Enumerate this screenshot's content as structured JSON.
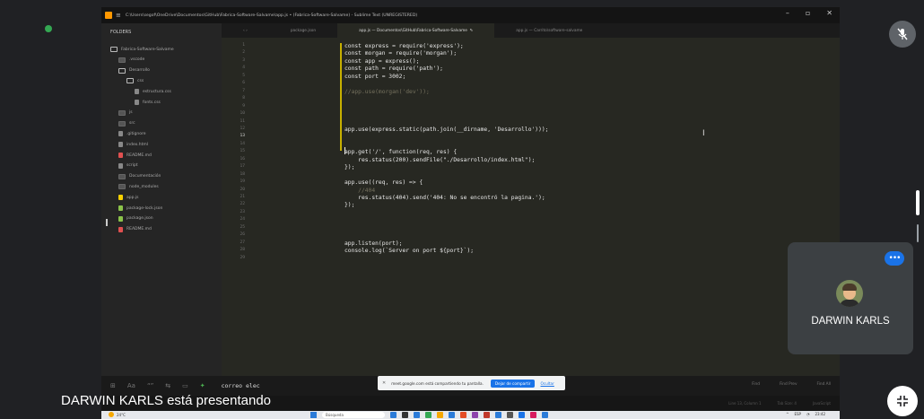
{
  "presenter_banner": "DARWIN KARLS está presentando",
  "participant": {
    "name": "DARWIN KARLS"
  },
  "window": {
    "title": "C:\\Users\\segof\\OneDrive\\Documentos\\GitHub\\Fabrica-Software-Salvame\\app.js • (Fabrica-Software-Salvame) - Sublime Text (UNREGISTERED)"
  },
  "sidebar": {
    "header": "FOLDERS",
    "items": [
      {
        "label": "Fabrica-Software-Salvame",
        "kind": "folder-open",
        "depth": 0
      },
      {
        "label": ".vscode",
        "kind": "folder",
        "depth": 1
      },
      {
        "label": "Desarrollo",
        "kind": "folder-open",
        "depth": 1
      },
      {
        "label": "css",
        "kind": "folder-open",
        "depth": 2
      },
      {
        "label": "estructura.css",
        "kind": "file",
        "depth": 3
      },
      {
        "label": "fonts.css",
        "kind": "file",
        "depth": 3
      },
      {
        "label": "js",
        "kind": "folder",
        "depth": 1
      },
      {
        "label": "src",
        "kind": "folder",
        "depth": 1
      },
      {
        "label": ".gitignore",
        "kind": "file",
        "depth": 1
      },
      {
        "label": "index.html",
        "kind": "file",
        "depth": 1
      },
      {
        "label": "README.md",
        "kind": "file",
        "depth": 1
      },
      {
        "label": "script",
        "kind": "file",
        "depth": 1
      },
      {
        "label": "Documentación",
        "kind": "folder",
        "depth": 1
      },
      {
        "label": "node_modules",
        "kind": "folder",
        "depth": 1
      },
      {
        "label": "app.js",
        "kind": "file",
        "depth": 1
      },
      {
        "label": "package-lock.json",
        "kind": "file",
        "depth": 1
      },
      {
        "label": "package.json",
        "kind": "file",
        "depth": 1
      },
      {
        "label": "README.md",
        "kind": "file",
        "depth": 1
      }
    ]
  },
  "tabs": [
    {
      "label": "package.json"
    },
    {
      "label": "app.js — Documentos\\GitHub\\Fabrica-Software-Salvame"
    },
    {
      "label": "app.js — Carrito\\software-salvame"
    }
  ],
  "code": {
    "current_line": "13",
    "lines": [
      {
        "n": "1",
        "text": "const express = require('express');",
        "comment": false
      },
      {
        "n": "2",
        "text": "const morgan = require('morgan');",
        "comment": false
      },
      {
        "n": "3",
        "text": "const app = express();",
        "comment": false
      },
      {
        "n": "4",
        "text": "const path = require('path');",
        "comment": false
      },
      {
        "n": "5",
        "text": "const port = 3002;",
        "comment": false
      },
      {
        "n": "6",
        "text": "",
        "comment": false
      },
      {
        "n": "7",
        "text": "//app.use(morgan('dev'));",
        "comment": true
      },
      {
        "n": "8",
        "text": "",
        "comment": false
      },
      {
        "n": "9",
        "text": "",
        "comment": false
      },
      {
        "n": "10",
        "text": "",
        "comment": false
      },
      {
        "n": "11",
        "text": "",
        "comment": false
      },
      {
        "n": "12",
        "text": "app.use(express.static(path.join(__dirname, 'Desarrollo')));",
        "comment": false
      },
      {
        "n": "13",
        "text": "",
        "comment": false
      },
      {
        "n": "14",
        "text": "",
        "comment": false
      },
      {
        "n": "15",
        "text": "app.get('/', function(req, res) {",
        "comment": false
      },
      {
        "n": "16",
        "text": "    res.status(200).sendFile(\"./Desarrollo/index.html\");",
        "comment": false
      },
      {
        "n": "17",
        "text": "});",
        "comment": false
      },
      {
        "n": "18",
        "text": "",
        "comment": false
      },
      {
        "n": "19",
        "text": "app.use((req, res) => {",
        "comment": false
      },
      {
        "n": "20",
        "text": "    //404",
        "comment": true
      },
      {
        "n": "21",
        "text": "    res.status(404).send('404: No se encontró la pagina.');",
        "comment": false
      },
      {
        "n": "22",
        "text": "});",
        "comment": false
      },
      {
        "n": "23",
        "text": "",
        "comment": false
      },
      {
        "n": "24",
        "text": "",
        "comment": false
      },
      {
        "n": "25",
        "text": "",
        "comment": false
      },
      {
        "n": "26",
        "text": "",
        "comment": false
      },
      {
        "n": "27",
        "text": "app.listen(port);",
        "comment": false
      },
      {
        "n": "28",
        "text": "console.log(`Server on port ${port}`);",
        "comment": false
      },
      {
        "n": "29",
        "text": "",
        "comment": false
      }
    ]
  },
  "find_panel": {
    "input_value": "correo elec",
    "buttons": [
      "Find",
      "Find Prev",
      "Find All"
    ]
  },
  "statusbar_small": [
    "Line 13, Column 1",
    "Tab Size: 4",
    "JavaScript"
  ],
  "share_notice": {
    "message": "meet.google.com está compartiendo tu pantalla.",
    "stop_label": "Dejar de compartir",
    "hide_label": "Ocultar"
  },
  "taskbar": {
    "weather": "24°C",
    "search_placeholder": "Búsqueda",
    "lang": "ESP",
    "time": "23:42",
    "app_colors": [
      "#2b7bd8",
      "#333333",
      "#2b7bd8",
      "#34a853",
      "#f6a800",
      "#2b7bd8",
      "#e44d26",
      "#8e44ad",
      "#c0392b",
      "#2b7bd8",
      "#555555",
      "#1a73e8",
      "#d81b60",
      "#2b7bd8"
    ]
  },
  "colors": {
    "meet_bg": "#202124",
    "accent": "#1a73e8",
    "editor_bg": "#272822"
  }
}
